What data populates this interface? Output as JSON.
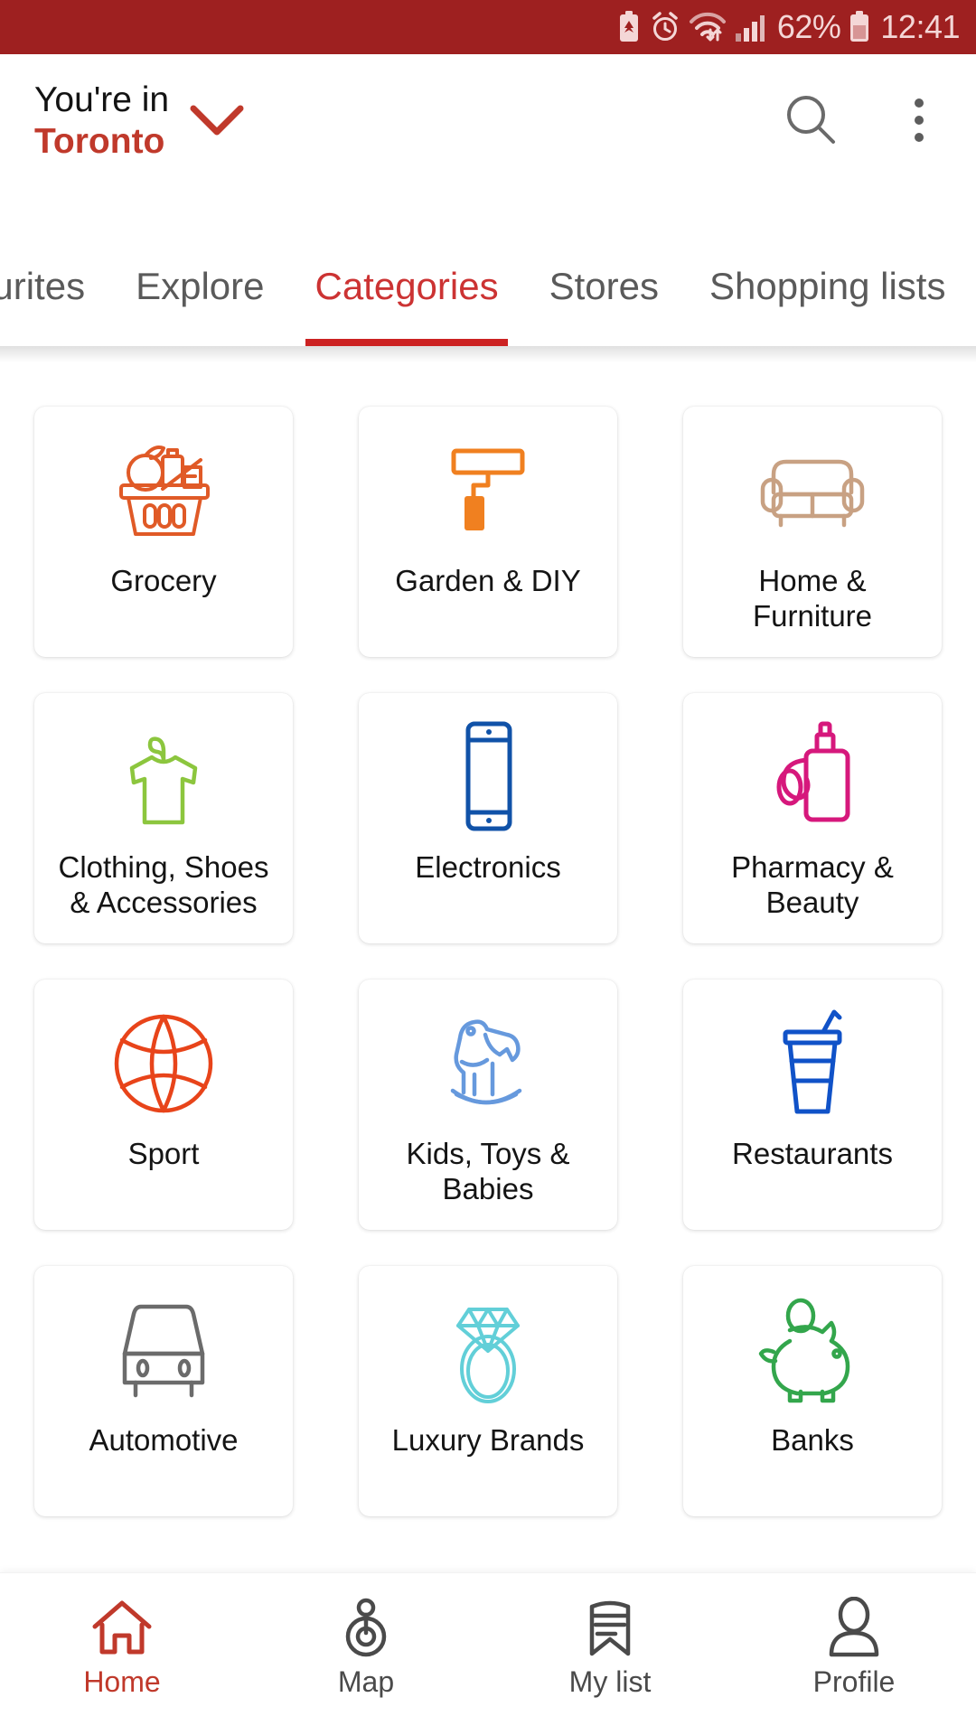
{
  "status_bar": {
    "background": "#9e2020",
    "battery_percent": "62%",
    "time": "12:41",
    "icons": [
      "battery-saver-icon",
      "alarm-clock-icon",
      "wifi-icon",
      "signal-bars-icon",
      "battery-icon"
    ]
  },
  "header": {
    "location_prefix": "You're in",
    "location_city": "Toronto",
    "chevron_icon": "chevron-down-icon",
    "search_icon": "search-icon",
    "overflow_icon": "overflow-menu-icon",
    "accent_color": "#c0392b"
  },
  "tabs": [
    {
      "label": "Favourites",
      "active": false
    },
    {
      "label": "Explore",
      "active": false
    },
    {
      "label": "Categories",
      "active": true
    },
    {
      "label": "Stores",
      "active": false
    },
    {
      "label": "Shopping lists",
      "active": false
    }
  ],
  "categories": [
    {
      "label": "Grocery",
      "icon": "grocery-basket-icon",
      "color": "#e05a27"
    },
    {
      "label": "Garden & DIY",
      "icon": "paint-roller-icon",
      "color": "#f08020"
    },
    {
      "label": "Home & Furniture",
      "icon": "sofa-icon",
      "color": "#c8a183"
    },
    {
      "label": "Clothing, Shoes & Accessories",
      "icon": "tshirt-hanger-icon",
      "color": "#8cc63e"
    },
    {
      "label": "Electronics",
      "icon": "smartphone-icon",
      "color": "#1052a8"
    },
    {
      "label": "Pharmacy & Beauty",
      "icon": "perfume-bottle-icon",
      "color": "#d6187c"
    },
    {
      "label": "Sport",
      "icon": "basketball-icon",
      "color": "#e8441a"
    },
    {
      "label": "Kids, Toys & Babies",
      "icon": "rocking-horse-icon",
      "color": "#6699dd"
    },
    {
      "label": "Restaurants",
      "icon": "drink-cup-icon",
      "color": "#1052c8"
    },
    {
      "label": "Automotive",
      "icon": "car-icon",
      "color": "#6b6b6b"
    },
    {
      "label": "Luxury Brands",
      "icon": "diamond-ring-icon",
      "color": "#62cfd8"
    },
    {
      "label": "Banks",
      "icon": "piggy-bank-icon",
      "color": "#33a64c"
    }
  ],
  "bottom_nav": [
    {
      "label": "Home",
      "icon": "home-icon",
      "active": true
    },
    {
      "label": "Map",
      "icon": "map-pin-icon",
      "active": false
    },
    {
      "label": "My list",
      "icon": "bookmark-list-icon",
      "active": false
    },
    {
      "label": "Profile",
      "icon": "person-icon",
      "active": false
    }
  ]
}
